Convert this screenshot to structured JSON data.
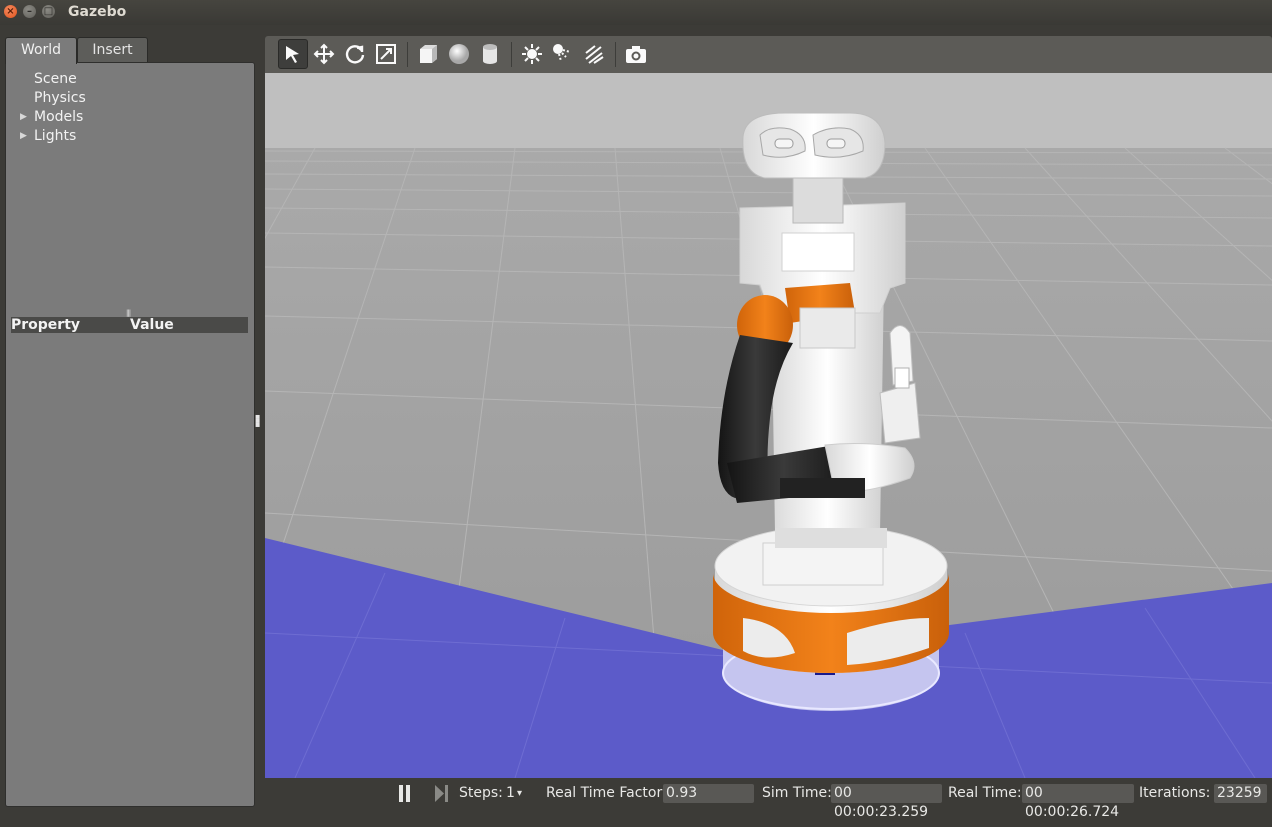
{
  "window": {
    "title": "Gazebo"
  },
  "tabs": {
    "world": "World",
    "insert": "Insert"
  },
  "world_tree": [
    {
      "label": "Scene",
      "expandable": false
    },
    {
      "label": "Physics",
      "expandable": false
    },
    {
      "label": "Models",
      "expandable": true
    },
    {
      "label": "Lights",
      "expandable": true
    }
  ],
  "property_table": {
    "col_property": "Property",
    "col_value": "Value"
  },
  "toolbar": {
    "tools": [
      "select-icon",
      "translate-icon",
      "rotate-icon",
      "scale-icon",
      "box-icon",
      "sphere-icon",
      "cylinder-icon",
      "point-light-icon",
      "spot-light-icon",
      "directional-light-icon",
      "screenshot-icon"
    ]
  },
  "status": {
    "steps_label": "Steps:",
    "steps_value": "1",
    "rtf_label": "Real Time Factor:",
    "rtf_value": "0.93",
    "sim_time_label": "Sim Time:",
    "sim_time_value": "00 00:00:23.259",
    "real_time_label": "Real Time:",
    "real_time_value": "00 00:00:26.724",
    "iterations_label": "Iterations:",
    "iterations_value": "23259"
  },
  "colors": {
    "accent_orange": "#e8740e",
    "ground_blue": "#5c5bc9",
    "grid_grey": "#a3a3a3"
  }
}
